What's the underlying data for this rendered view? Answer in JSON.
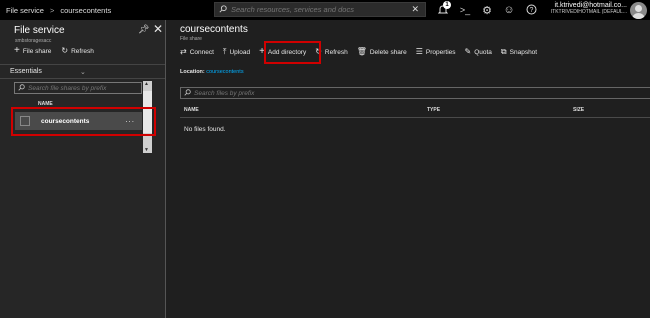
{
  "topbar": {
    "breadcrumb": [
      "File service",
      "coursecontents"
    ],
    "breadcrumb_sep": ">",
    "search_placeholder": "Search resources, services and docs",
    "notification_count": "1",
    "account_email": "it.ktrivedi@hotmail.co...",
    "account_directory": "ITKTRIVEDIHOTMAIL (DEFAUL..."
  },
  "left_blade": {
    "title": "File service",
    "subtitle": "smbstoragesacc",
    "toolbar": [
      "File share",
      "Refresh"
    ],
    "essentials_label": "Essentials",
    "search_placeholder": "Search file shares by prefix",
    "column_header": "NAME",
    "rows": [
      {
        "name": "coursecontents",
        "more": "..."
      }
    ]
  },
  "right_blade": {
    "title": "coursecontents",
    "subtitle": "File share",
    "toolbar": [
      "Connect",
      "Upload",
      "Add directory",
      "Refresh",
      "Delete share",
      "Properties",
      "Quota",
      "Snapshot"
    ],
    "location_label": "Location:",
    "location_value": "coursecontents",
    "search_placeholder": "Search files by prefix",
    "columns": [
      "NAME",
      "TYPE",
      "SIZE"
    ],
    "empty_message": "No files found."
  },
  "colors": {
    "highlight": "#d00000",
    "link": "#00b0ff",
    "background": "#1f1f1f"
  }
}
